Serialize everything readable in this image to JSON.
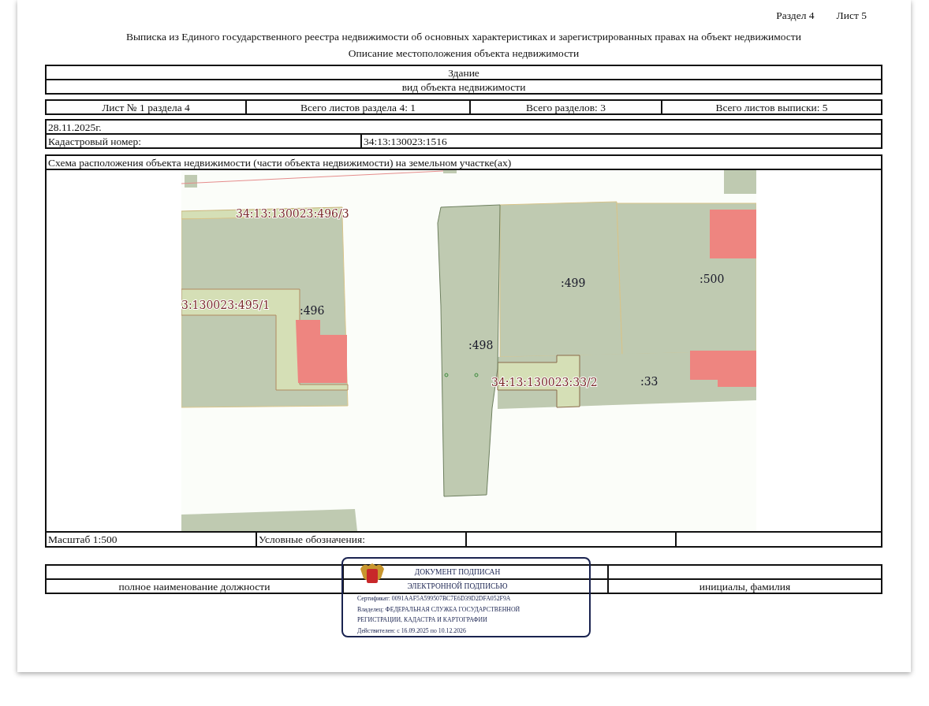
{
  "page_header": {
    "section": "Раздел 4",
    "sheet": "Лист 5"
  },
  "title": "Выписка из Единого государственного реестра недвижимости об основных характеристиках и зарегистрированных правах на объект недвижимости",
  "subtitle": "Описание местоположения объекта недвижимости",
  "object": {
    "type": "Здание",
    "caption": "вид объекта недвижимости"
  },
  "sheet_info": [
    "Лист № 1 раздела 4",
    "Всего листов раздела 4: 1",
    "Всего разделов: 3",
    "Всего листов выписки: 5"
  ],
  "date": "28.11.2025г.",
  "cadastral": {
    "label": "Кадастровый номер:",
    "value": "34:13:130023:1516"
  },
  "scheme": {
    "heading": "Схема расположения объекта недвижимости (части объекта недвижимости) на земельном участке(ах)",
    "labels": [
      {
        "text": "34:13:130023:496/3",
        "kind": "number"
      },
      {
        "text": "3:130023:495/1",
        "kind": "number"
      },
      {
        "text": ":496",
        "kind": "parcel"
      },
      {
        "text": ":499",
        "kind": "parcel"
      },
      {
        "text": ":500",
        "kind": "parcel"
      },
      {
        "text": ":498",
        "kind": "parcel"
      },
      {
        "text": "34:13:130023:33/2",
        "kind": "number"
      },
      {
        "text": ":33",
        "kind": "parcel"
      }
    ],
    "scale": "Масштаб 1:500",
    "legend": "Условные обозначения:"
  },
  "signature": {
    "position": "полное наименование должности",
    "name": "инициалы, фамилия"
  },
  "stamp": {
    "lines": [
      "ДОКУМЕНТ ПОДПИСАН",
      "ЭЛЕКТРОННОЙ ПОДПИСЬЮ"
    ],
    "details": [
      "Сертификат: 0091AAF5A599507BC7E6D39D2DFA052F9A",
      "Владелец: ФЕДЕРАЛЬНАЯ СЛУЖБА ГОСУДАРСТВЕННОЙ",
      "РЕГИСТРАЦИИ, КАДАСТРА И КАРТОГРАФИИ",
      "Действителен: с 16.09.2025 по 10.12.2026"
    ]
  }
}
